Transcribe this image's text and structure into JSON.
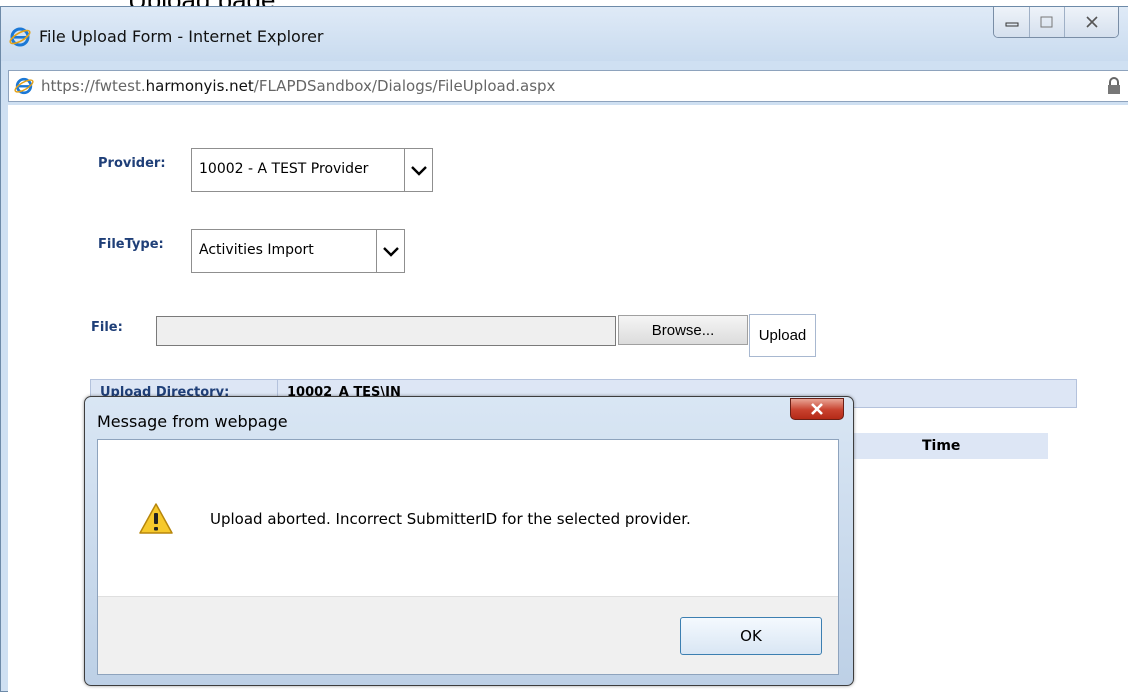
{
  "background_caption": "Upload page.",
  "window": {
    "title": "File Upload Form - Internet Explorer",
    "url_prefix": "https://fwtest.",
    "url_host": "harmonyis.net",
    "url_path": "/FLAPDSandbox/Dialogs/FileUpload.aspx"
  },
  "form": {
    "provider_label": "Provider:",
    "provider_value": "10002 - A TEST Provider",
    "filetype_label": "FileType:",
    "filetype_value": "Activities Import",
    "file_label": "File:",
    "file_value": "",
    "browse_label": "Browse...",
    "upload_label": "Upload",
    "upload_directory_label": "Upload Directory:",
    "upload_directory_value": "10002_A TES\\IN",
    "grid_time_header": "Time"
  },
  "dialog": {
    "title": "Message from webpage",
    "message": "Upload aborted. Incorrect SubmitterID for the selected provider.",
    "ok_label": "OK"
  },
  "icons": {
    "browser": "ie-logo-icon",
    "lock": "lock-icon",
    "warning": "warning-icon",
    "close": "close-icon"
  },
  "colors": {
    "label_blue": "#1f3f78",
    "header_fill": "#dde6f5",
    "dialog_close_red": "#c8412e"
  }
}
